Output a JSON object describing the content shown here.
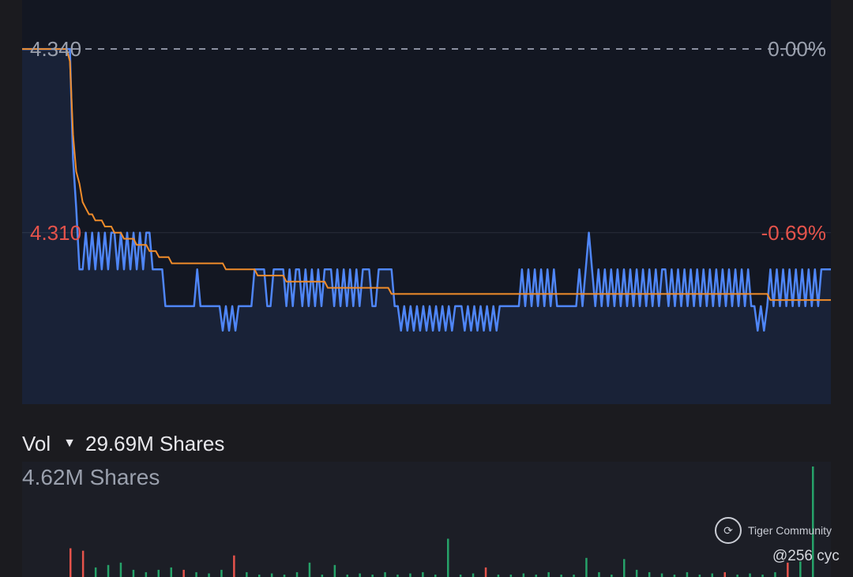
{
  "price_chart": {
    "labels": {
      "top_price": "4.340",
      "top_pct": "0.00%",
      "mid_price": "4.310",
      "mid_pct": "-0.69%"
    },
    "colors": {
      "price_line": "#4f86f7",
      "avg_line": "#f08c2a",
      "neutral_text": "#9aa0ad",
      "down_text": "#e5534b",
      "background": "#131722"
    }
  },
  "volume": {
    "header_label": "Vol",
    "dropdown_icon": "caret-down-icon",
    "total": "29.69M Shares",
    "max_label": "4.62M Shares",
    "colors": {
      "up": "#26a269",
      "down": "#e5534b"
    }
  },
  "watermark": {
    "brand": "Tiger Community",
    "user": "@256 cyc"
  },
  "chart_data": {
    "type": "line",
    "title": "",
    "xlabel": "",
    "ylabel": "",
    "ylim": [
      4.282,
      4.348
    ],
    "reference_price": 4.34,
    "series": [
      {
        "values": [
          4.34,
          4.34,
          4.34,
          4.34,
          4.34,
          4.34,
          4.34,
          4.34,
          4.34,
          4.34,
          4.34,
          4.34,
          4.34,
          4.34,
          4.34,
          4.34,
          4.322,
          4.314,
          4.304,
          4.304,
          4.31,
          4.304,
          4.31,
          4.304,
          4.31,
          4.304,
          4.31,
          4.304,
          4.31,
          4.31,
          4.304,
          4.31,
          4.304,
          4.31,
          4.304,
          4.31,
          4.304,
          4.31,
          4.304,
          4.31,
          4.31,
          4.304,
          4.304,
          4.304,
          4.304,
          4.298,
          4.298,
          4.298,
          4.298,
          4.298,
          4.298,
          4.298,
          4.298,
          4.298,
          4.298,
          4.304,
          4.298,
          4.298,
          4.298,
          4.298,
          4.298,
          4.298,
          4.298,
          4.294,
          4.298,
          4.294,
          4.298,
          4.294,
          4.298,
          4.298,
          4.298,
          4.298,
          4.298,
          4.304,
          4.304,
          4.304,
          4.304,
          4.298,
          4.298,
          4.304,
          4.304,
          4.304,
          4.304,
          4.298,
          4.304,
          4.298,
          4.304,
          4.304,
          4.298,
          4.304,
          4.298,
          4.304,
          4.298,
          4.304,
          4.298,
          4.304,
          4.304,
          4.304,
          4.298,
          4.304,
          4.298,
          4.304,
          4.298,
          4.304,
          4.298,
          4.304,
          4.298,
          4.304,
          4.304,
          4.304,
          4.298,
          4.298,
          4.304,
          4.304,
          4.304,
          4.304,
          4.304,
          4.298,
          4.298,
          4.294,
          4.298,
          4.294,
          4.298,
          4.294,
          4.298,
          4.294,
          4.298,
          4.294,
          4.298,
          4.294,
          4.298,
          4.294,
          4.298,
          4.294,
          4.298,
          4.294,
          4.298,
          4.298,
          4.298,
          4.294,
          4.298,
          4.294,
          4.298,
          4.294,
          4.298,
          4.294,
          4.298,
          4.294,
          4.298,
          4.294,
          4.298,
          4.298,
          4.298,
          4.298,
          4.298,
          4.298,
          4.298,
          4.304,
          4.298,
          4.304,
          4.298,
          4.304,
          4.298,
          4.304,
          4.298,
          4.304,
          4.298,
          4.304,
          4.298,
          4.298,
          4.298,
          4.298,
          4.298,
          4.298,
          4.298,
          4.304,
          4.298,
          4.304,
          4.31,
          4.304,
          4.298,
          4.304,
          4.298,
          4.304,
          4.298,
          4.304,
          4.298,
          4.304,
          4.298,
          4.304,
          4.298,
          4.304,
          4.298,
          4.304,
          4.298,
          4.304,
          4.298,
          4.304,
          4.298,
          4.304,
          4.298,
          4.304,
          4.304,
          4.298,
          4.304,
          4.298,
          4.304,
          4.298,
          4.304,
          4.298,
          4.304,
          4.298,
          4.304,
          4.298,
          4.304,
          4.298,
          4.304,
          4.298,
          4.304,
          4.298,
          4.304,
          4.298,
          4.304,
          4.298,
          4.304,
          4.298,
          4.304,
          4.298,
          4.304,
          4.298,
          4.298,
          4.294,
          4.298,
          4.294,
          4.298,
          4.304,
          4.298,
          4.304,
          4.298,
          4.304,
          4.298,
          4.304,
          4.298,
          4.304,
          4.298,
          4.304,
          4.298,
          4.304,
          4.298,
          4.304,
          4.298,
          4.304,
          4.304,
          4.304,
          4.304
        ]
      },
      {
        "values": [
          4.34,
          4.34,
          4.34,
          4.34,
          4.34,
          4.34,
          4.34,
          4.34,
          4.34,
          4.34,
          4.34,
          4.34,
          4.34,
          4.34,
          4.34,
          4.338,
          4.326,
          4.32,
          4.318,
          4.315,
          4.314,
          4.313,
          4.313,
          4.312,
          4.312,
          4.312,
          4.311,
          4.311,
          4.311,
          4.31,
          4.31,
          4.31,
          4.309,
          4.309,
          4.309,
          4.309,
          4.308,
          4.308,
          4.308,
          4.308,
          4.307,
          4.307,
          4.307,
          4.306,
          4.306,
          4.306,
          4.306,
          4.305,
          4.305,
          4.305,
          4.305,
          4.305,
          4.305,
          4.305,
          4.305,
          4.305,
          4.305,
          4.305,
          4.305,
          4.305,
          4.305,
          4.305,
          4.305,
          4.305,
          4.304,
          4.304,
          4.304,
          4.304,
          4.304,
          4.304,
          4.304,
          4.304,
          4.304,
          4.304,
          4.303,
          4.303,
          4.303,
          4.303,
          4.303,
          4.303,
          4.303,
          4.303,
          4.303,
          4.302,
          4.302,
          4.302,
          4.302,
          4.302,
          4.302,
          4.302,
          4.302,
          4.302,
          4.302,
          4.302,
          4.302,
          4.302,
          4.301,
          4.301,
          4.301,
          4.301,
          4.301,
          4.301,
          4.301,
          4.301,
          4.301,
          4.301,
          4.301,
          4.301,
          4.301,
          4.301,
          4.301,
          4.301,
          4.301,
          4.301,
          4.301,
          4.301,
          4.3,
          4.3,
          4.3,
          4.3,
          4.3,
          4.3,
          4.3,
          4.3,
          4.3,
          4.3,
          4.3,
          4.3,
          4.3,
          4.3,
          4.3,
          4.3,
          4.3,
          4.3,
          4.3,
          4.3,
          4.3,
          4.3,
          4.3,
          4.3,
          4.3,
          4.3,
          4.3,
          4.3,
          4.3,
          4.3,
          4.3,
          4.3,
          4.3,
          4.3,
          4.3,
          4.3,
          4.3,
          4.3,
          4.3,
          4.3,
          4.3,
          4.3,
          4.3,
          4.3,
          4.3,
          4.3,
          4.3,
          4.3,
          4.3,
          4.3,
          4.3,
          4.3,
          4.3,
          4.3,
          4.3,
          4.3,
          4.3,
          4.3,
          4.3,
          4.3,
          4.3,
          4.3,
          4.3,
          4.3,
          4.3,
          4.3,
          4.3,
          4.3,
          4.3,
          4.3,
          4.3,
          4.3,
          4.3,
          4.3,
          4.3,
          4.3,
          4.3,
          4.3,
          4.3,
          4.3,
          4.3,
          4.3,
          4.3,
          4.3,
          4.3,
          4.3,
          4.3,
          4.3,
          4.3,
          4.3,
          4.3,
          4.3,
          4.3,
          4.3,
          4.3,
          4.3,
          4.3,
          4.3,
          4.3,
          4.3,
          4.3,
          4.3,
          4.3,
          4.3,
          4.3,
          4.3,
          4.3,
          4.3,
          4.3,
          4.3,
          4.3,
          4.3,
          4.3,
          4.3,
          4.3,
          4.3,
          4.3,
          4.3,
          4.3,
          4.299,
          4.299,
          4.299,
          4.299,
          4.299,
          4.299,
          4.299,
          4.299,
          4.299,
          4.299,
          4.299,
          4.299,
          4.299,
          4.299,
          4.299,
          4.299,
          4.299,
          4.299,
          4.299,
          4.299,
          4.299,
          4.299,
          4.299,
          4.299,
          4.299,
          4.299,
          4.3,
          4.3,
          4.3
        ]
      }
    ],
    "volume_bars": [
      {
        "v": 1.2,
        "dir": "down"
      },
      {
        "v": 1.1,
        "dir": "down"
      },
      {
        "v": 0.4,
        "dir": "up"
      },
      {
        "v": 0.5,
        "dir": "up"
      },
      {
        "v": 0.6,
        "dir": "up"
      },
      {
        "v": 0.3,
        "dir": "up"
      },
      {
        "v": 0.2,
        "dir": "up"
      },
      {
        "v": 0.3,
        "dir": "up"
      },
      {
        "v": 0.4,
        "dir": "up"
      },
      {
        "v": 0.3,
        "dir": "down"
      },
      {
        "v": 0.2,
        "dir": "up"
      },
      {
        "v": 0.15,
        "dir": "up"
      },
      {
        "v": 0.3,
        "dir": "up"
      },
      {
        "v": 0.9,
        "dir": "down"
      },
      {
        "v": 0.2,
        "dir": "up"
      },
      {
        "v": 0.1,
        "dir": "up"
      },
      {
        "v": 0.15,
        "dir": "up"
      },
      {
        "v": 0.1,
        "dir": "up"
      },
      {
        "v": 0.2,
        "dir": "up"
      },
      {
        "v": 0.6,
        "dir": "up"
      },
      {
        "v": 0.1,
        "dir": "up"
      },
      {
        "v": 0.5,
        "dir": "up"
      },
      {
        "v": 0.1,
        "dir": "up"
      },
      {
        "v": 0.15,
        "dir": "up"
      },
      {
        "v": 0.1,
        "dir": "up"
      },
      {
        "v": 0.2,
        "dir": "up"
      },
      {
        "v": 0.1,
        "dir": "up"
      },
      {
        "v": 0.15,
        "dir": "up"
      },
      {
        "v": 0.2,
        "dir": "up"
      },
      {
        "v": 0.1,
        "dir": "up"
      },
      {
        "v": 1.6,
        "dir": "up"
      },
      {
        "v": 0.1,
        "dir": "up"
      },
      {
        "v": 0.15,
        "dir": "up"
      },
      {
        "v": 0.4,
        "dir": "down"
      },
      {
        "v": 0.1,
        "dir": "up"
      },
      {
        "v": 0.1,
        "dir": "up"
      },
      {
        "v": 0.15,
        "dir": "up"
      },
      {
        "v": 0.1,
        "dir": "up"
      },
      {
        "v": 0.2,
        "dir": "up"
      },
      {
        "v": 0.1,
        "dir": "up"
      },
      {
        "v": 0.1,
        "dir": "up"
      },
      {
        "v": 0.8,
        "dir": "up"
      },
      {
        "v": 0.2,
        "dir": "up"
      },
      {
        "v": 0.1,
        "dir": "up"
      },
      {
        "v": 0.75,
        "dir": "up"
      },
      {
        "v": 0.3,
        "dir": "up"
      },
      {
        "v": 0.2,
        "dir": "up"
      },
      {
        "v": 0.15,
        "dir": "up"
      },
      {
        "v": 0.1,
        "dir": "up"
      },
      {
        "v": 0.2,
        "dir": "up"
      },
      {
        "v": 0.1,
        "dir": "up"
      },
      {
        "v": 0.15,
        "dir": "up"
      },
      {
        "v": 0.2,
        "dir": "down"
      },
      {
        "v": 0.1,
        "dir": "up"
      },
      {
        "v": 0.15,
        "dir": "up"
      },
      {
        "v": 0.1,
        "dir": "up"
      },
      {
        "v": 0.2,
        "dir": "up"
      },
      {
        "v": 0.6,
        "dir": "down"
      },
      {
        "v": 0.65,
        "dir": "up"
      },
      {
        "v": 4.62,
        "dir": "up"
      }
    ]
  }
}
